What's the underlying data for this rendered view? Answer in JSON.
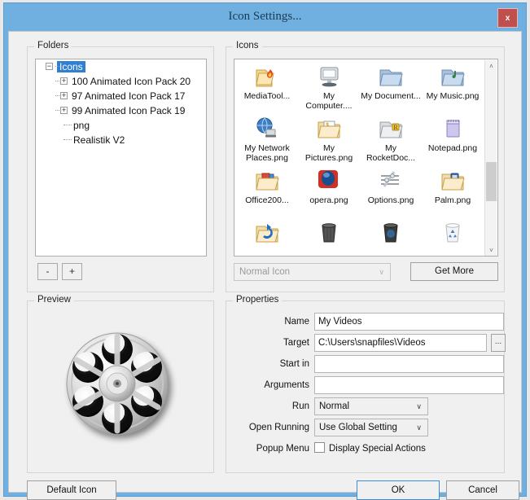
{
  "window": {
    "title": "Icon Settings...",
    "close_label": "x",
    "accent_color": "#6fb0e0",
    "close_color": "#c0504d"
  },
  "folders": {
    "group_label": "Folders",
    "tree": [
      {
        "label": "Icons",
        "expander": "−",
        "selected": true,
        "level": 0
      },
      {
        "label": "100 Animated Icon Pack  20",
        "expander": "+",
        "selected": false,
        "level": 1
      },
      {
        "label": "97 Animated Icon Pack  17",
        "expander": "+",
        "selected": false,
        "level": 1
      },
      {
        "label": "99 Animated Icon Pack  19",
        "expander": "+",
        "selected": false,
        "level": 1
      },
      {
        "label": "png",
        "expander": "",
        "selected": false,
        "level": 1
      },
      {
        "label": "Realistik V2",
        "expander": "",
        "selected": false,
        "level": 1
      }
    ],
    "remove_button": "-",
    "add_button": "+"
  },
  "icons": {
    "group_label": "Icons",
    "items": [
      {
        "caption": "MediaTool...",
        "icon": "folder-flame-icon"
      },
      {
        "caption": "My Computer....",
        "icon": "monitor-icon"
      },
      {
        "caption": "My Document...",
        "icon": "folder-blue-icon"
      },
      {
        "caption": "My Music.png",
        "icon": "folder-music-icon"
      },
      {
        "caption": "My Network Places.png",
        "icon": "globe-network-icon"
      },
      {
        "caption": "My Pictures.png",
        "icon": "folder-pictures-icon"
      },
      {
        "caption": "My RocketDoc...",
        "icon": "folder-rocketdock-icon"
      },
      {
        "caption": "Notepad.png",
        "icon": "notepad-icon"
      },
      {
        "caption": "Office200...",
        "icon": "folder-office-icon"
      },
      {
        "caption": "opera.png",
        "icon": "opera-icon"
      },
      {
        "caption": "Options.png",
        "icon": "options-sliders-icon"
      },
      {
        "caption": "Palm.png",
        "icon": "folder-palm-icon"
      },
      {
        "caption": "",
        "icon": "folder-refresh-icon"
      },
      {
        "caption": "",
        "icon": "trash-dark-icon"
      },
      {
        "caption": "",
        "icon": "trash-blue-icon"
      },
      {
        "caption": "",
        "icon": "recycle-bin-icon"
      }
    ],
    "type_select": {
      "value": "Normal Icon",
      "caret": "∨"
    },
    "get_more_button": "Get More",
    "scrollbar": {
      "up": "˄",
      "down": "˅"
    }
  },
  "preview": {
    "group_label": "Preview",
    "image_name": "film-reel-icon"
  },
  "properties": {
    "group_label": "Properties",
    "fields": [
      {
        "label": "Name",
        "value": "My Videos",
        "type": "text"
      },
      {
        "label": "Target",
        "value": "C:\\Users\\snapfiles\\Videos",
        "type": "text"
      },
      {
        "label": "Start in",
        "value": "",
        "type": "text"
      },
      {
        "label": "Arguments",
        "value": "",
        "type": "text"
      },
      {
        "label": "Run",
        "value": "Normal",
        "type": "combo"
      },
      {
        "label": "Open Running",
        "value": "Use Global Setting",
        "type": "combo"
      },
      {
        "label": "Popup Menu",
        "value": "Display Special Actions",
        "type": "checkbox"
      }
    ],
    "browse_button": "...",
    "caret": "∨",
    "checkbox_checked": false
  },
  "buttons": {
    "default_icon": "Default Icon",
    "ok": "OK",
    "cancel": "Cancel"
  }
}
